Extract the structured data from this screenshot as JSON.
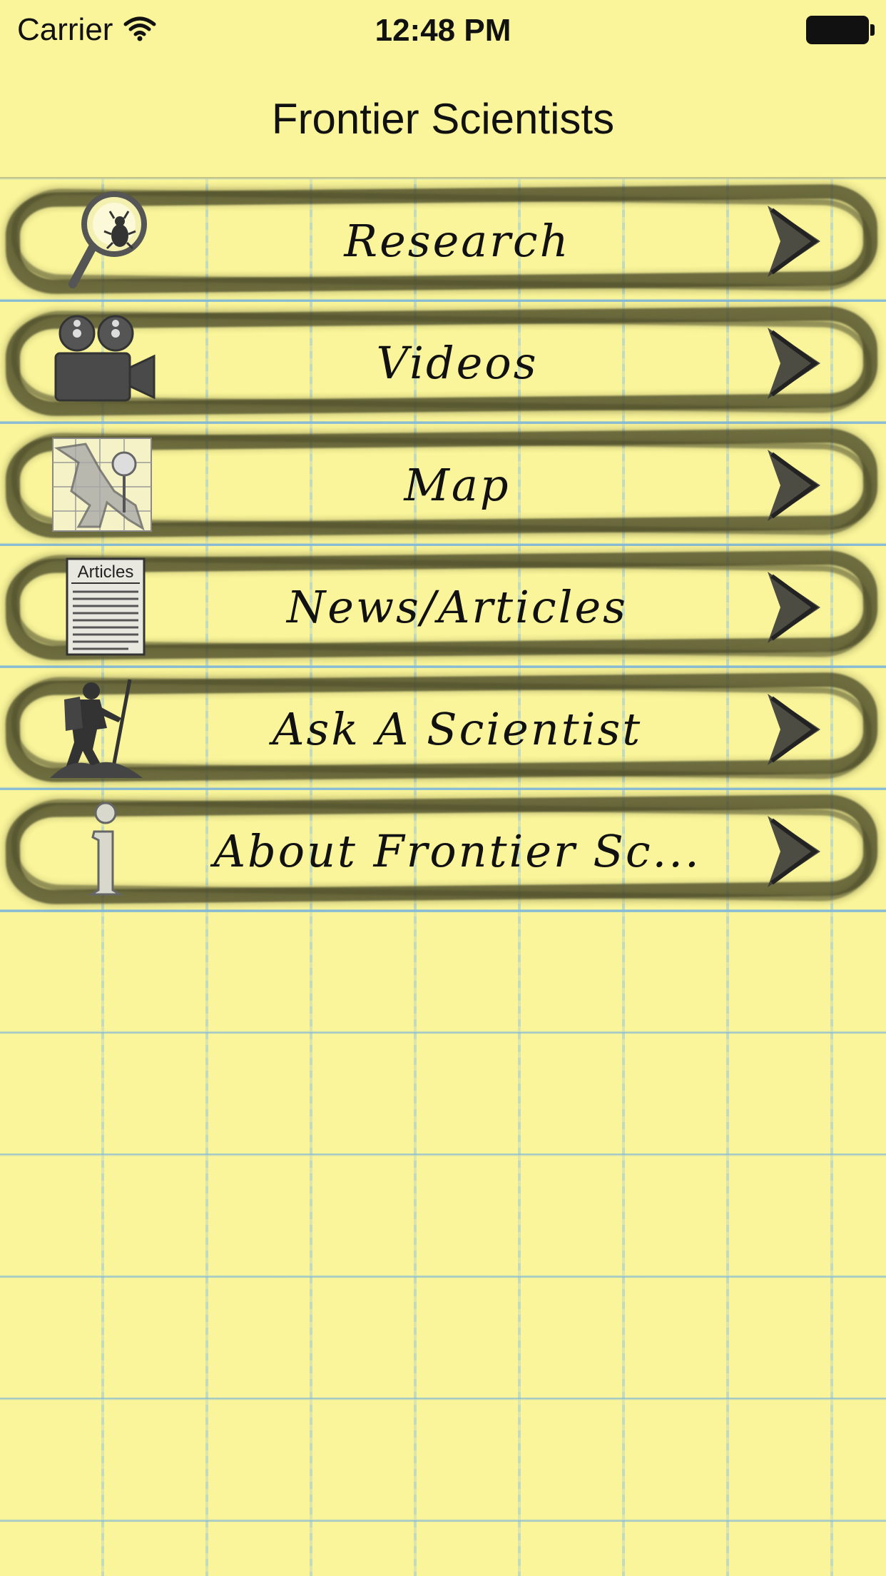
{
  "status_bar": {
    "carrier": "Carrier",
    "time": "12:48 PM"
  },
  "nav": {
    "title": "Frontier Scientists"
  },
  "menu": {
    "items": [
      {
        "label": "Research",
        "icon": "magnifier-bug-icon"
      },
      {
        "label": "Videos",
        "icon": "film-camera-icon"
      },
      {
        "label": "Map",
        "icon": "map-pin-icon"
      },
      {
        "label": "News/Articles",
        "icon": "newspaper-icon"
      },
      {
        "label": "Ask A Scientist",
        "icon": "hiker-icon"
      },
      {
        "label": "About Frontier Sc...",
        "icon": "info-icon"
      }
    ],
    "newspaper_heading": "Articles"
  },
  "colors": {
    "paper": "#faf59a",
    "rule_line": "#82b9d7",
    "scribble": "#4a4a28",
    "text": "#111111"
  }
}
